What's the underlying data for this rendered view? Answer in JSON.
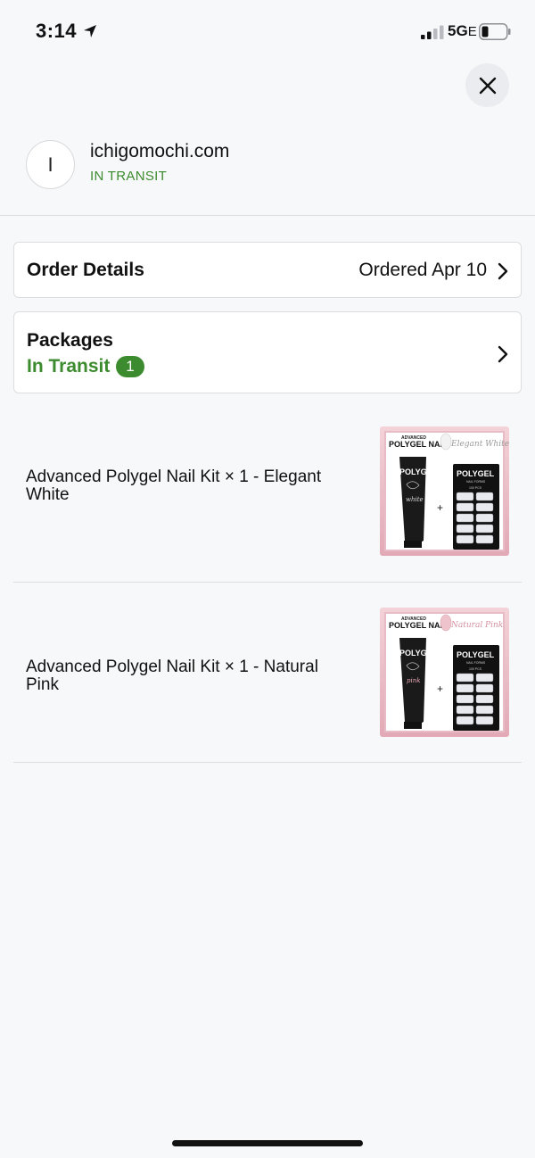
{
  "status_bar": {
    "time": "3:14",
    "network": "5G",
    "network_suffix": "E",
    "location_icon": "location-arrow-icon",
    "signal_icon": "signal-bars-icon",
    "battery_icon": "battery-icon"
  },
  "close_icon": "close-icon",
  "merchant": {
    "initial": "I",
    "name": "ichigomochi.com",
    "status": "IN TRANSIT"
  },
  "order_details": {
    "label": "Order Details",
    "date": "Ordered Apr 10",
    "chevron_icon": "chevron-right-icon"
  },
  "packages": {
    "label": "Packages",
    "status": "In Transit",
    "count": "1",
    "chevron_icon": "chevron-right-icon"
  },
  "items": [
    {
      "title": "Advanced Polygel Nail Kit × 1 - Elegant White",
      "thumb": {
        "brand_top": "ADVANCED",
        "brand_main": "POLYGEL NAIL",
        "variant_script": "Elegant White",
        "tube_label": "POLYGEL",
        "tube_script": "white",
        "box_label": "POLYGEL",
        "box_sub": "NAIL FORMS",
        "box_count": "100 PCS",
        "plus": "+"
      }
    },
    {
      "title": "Advanced Polygel Nail Kit × 1 - Natural Pink",
      "thumb": {
        "brand_top": "ADVANCED",
        "brand_main": "POLYGEL NAIL",
        "variant_script": "Natural Pink",
        "tube_label": "POLYGEL",
        "tube_script": "pink",
        "box_label": "POLYGEL",
        "box_sub": "NAIL FORMS",
        "box_count": "100 PCS",
        "plus": "+"
      }
    }
  ],
  "colors": {
    "accent_green": "#3d8b2f",
    "background": "#f7f8fa",
    "thumb_pink": "#e9b9c2"
  }
}
